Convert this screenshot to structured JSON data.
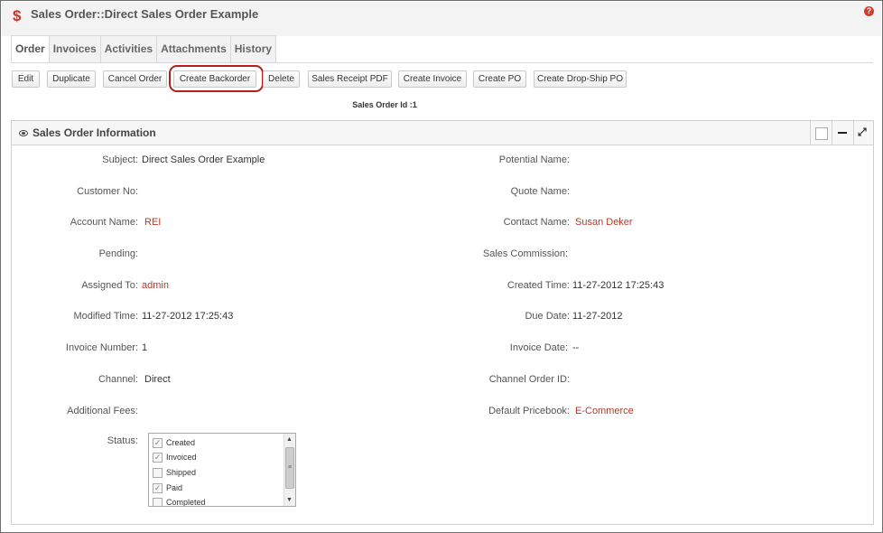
{
  "header": {
    "title": "Sales Order::Direct Sales Order Example",
    "help_icon": "?"
  },
  "tabs": [
    {
      "label": "Order"
    },
    {
      "label": "Invoices"
    },
    {
      "label": "Activities"
    },
    {
      "label": "Attachments"
    },
    {
      "label": "History"
    }
  ],
  "toolbar": {
    "edit": "Edit",
    "duplicate": "Duplicate",
    "cancel_order": "Cancel Order",
    "create_backorder": "Create Backorder",
    "delete": "Delete",
    "sales_receipt_pdf": "Sales Receipt PDF",
    "create_invoice": "Create Invoice",
    "create_po": "Create PO",
    "create_dropship_po": "Create Drop-Ship PO"
  },
  "sales_order_id": "Sales Order Id :1",
  "panel": {
    "title": "Sales Order Information"
  },
  "fields_left": [
    {
      "label": "Subject:",
      "value": "Direct Sales Order Example"
    },
    {
      "label": "Customer No:",
      "value": ""
    },
    {
      "label": "Account Name:",
      "value": "REI"
    },
    {
      "label": "Pending:",
      "value": ""
    },
    {
      "label": "Assigned To:",
      "value": "admin"
    },
    {
      "label": "Modified Time:",
      "value": "11-27-2012 17:25:43"
    },
    {
      "label": "Invoice Number:",
      "value": "1"
    },
    {
      "label": "Channel:",
      "value": "Direct"
    },
    {
      "label": "Additional Fees:",
      "value": ""
    },
    {
      "label": "Status:",
      "value": ""
    }
  ],
  "fields_right": [
    {
      "label": "Potential Name:",
      "value": ""
    },
    {
      "label": "Quote Name:",
      "value": ""
    },
    {
      "label": "Contact Name:",
      "value": "Susan Deker"
    },
    {
      "label": "Sales Commission:",
      "value": ""
    },
    {
      "label": "Created Time:",
      "value": "11-27-2012 17:25:43"
    },
    {
      "label": "Due Date:",
      "value": "11-27-2012"
    },
    {
      "label": "Invoice Date:",
      "value": "--"
    },
    {
      "label": "Channel Order ID:",
      "value": ""
    },
    {
      "label": "Default Pricebook:",
      "value": "E-Commerce"
    }
  ],
  "status_options": [
    {
      "label": "Created",
      "checked": true
    },
    {
      "label": "Invoiced",
      "checked": true
    },
    {
      "label": "Shipped",
      "checked": false
    },
    {
      "label": "Paid",
      "checked": true
    },
    {
      "label": "Completed",
      "checked": false
    }
  ],
  "colors": {
    "accent": "#b5392b",
    "highlight_ring": "#b41e1e"
  }
}
